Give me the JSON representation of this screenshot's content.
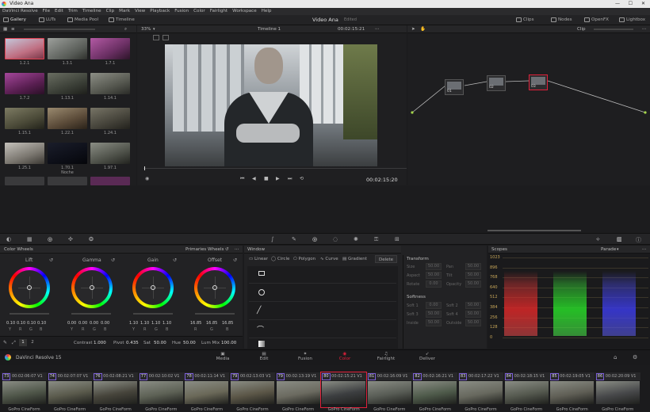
{
  "window": {
    "title": "Video Ana"
  },
  "menu": [
    "DaVinci Resolve",
    "File",
    "Edit",
    "Trim",
    "Timeline",
    "Clip",
    "Mark",
    "View",
    "Playback",
    "Fusion",
    "Color",
    "Fairlight",
    "Workspace",
    "Help"
  ],
  "toolbar": {
    "gallery": "Gallery",
    "luts": "LUTs",
    "media_pool": "Media Pool",
    "timeline": "Timeline",
    "project_name": "Video Ana",
    "edited": "Edited",
    "clips": "Clips",
    "nodes": "Nodes",
    "openfx": "OpenFX",
    "lightbox": "Lightbox"
  },
  "viewer": {
    "zoom": "33%",
    "timeline_name": "Timeline 1",
    "timecode_top": "00:02:15:21",
    "timecode": "00:02:15:20",
    "clip_mode": "Clip"
  },
  "gallery": {
    "labels": [
      "1.2.1",
      "1.3.1",
      "1.7.1",
      "1.7.2",
      "1.13.1",
      "1.14.1",
      "1.15.1",
      "1.22.1",
      "1.24.1",
      "1.25.1",
      "1.70.1",
      "1.97.1"
    ],
    "noche": "Noche"
  },
  "clips": [
    {
      "num": "73",
      "tc": "00:02:06:07",
      "track": "V1"
    },
    {
      "num": "74",
      "tc": "00:02:07:07",
      "track": "V1"
    },
    {
      "num": "76",
      "tc": "00:02:08:21",
      "track": "V1"
    },
    {
      "num": "77",
      "tc": "00:02:10:02",
      "track": "V1"
    },
    {
      "num": "78",
      "tc": "00:02:11:14",
      "track": "V1"
    },
    {
      "num": "79",
      "tc": "00:02:13:03",
      "track": "V1"
    },
    {
      "num": "79",
      "tc": "00:02:13:19",
      "track": "V1"
    },
    {
      "num": "80",
      "tc": "00:02:15:21",
      "track": "V1"
    },
    {
      "num": "81",
      "tc": "00:02:16:09",
      "track": "V1"
    },
    {
      "num": "82",
      "tc": "00:02:16:21",
      "track": "V1"
    },
    {
      "num": "83",
      "tc": "00:02:17:22",
      "track": "V1"
    },
    {
      "num": "84",
      "tc": "00:02:18:15",
      "track": "V1"
    },
    {
      "num": "85",
      "tc": "00:02:19:05",
      "track": "V1"
    },
    {
      "num": "86",
      "tc": "00:02:20:09",
      "track": "V1"
    }
  ],
  "clip_codec": "GoPro CineForm",
  "nodes": {
    "n1": "01",
    "n2": "02",
    "n3": "03"
  },
  "color_wheels": {
    "title": "Color Wheels",
    "mode": "Primaries Wheels",
    "wheels": [
      {
        "name": "Lift",
        "values": [
          "0.10",
          "0.10",
          "0.10",
          "0.10"
        ]
      },
      {
        "name": "Gamma",
        "values": [
          "0.00",
          "0.00",
          "0.00",
          "0.00"
        ]
      },
      {
        "name": "Gain",
        "values": [
          "1.10",
          "1.10",
          "1.10",
          "1.10"
        ]
      },
      {
        "name": "Offset",
        "values": [
          "16.85",
          "16.85",
          "16.85"
        ]
      }
    ],
    "chan_ybrg": [
      "Y",
      "R",
      "G",
      "B"
    ],
    "chan_rgb": [
      "R",
      "G",
      "B"
    ],
    "page1": "1",
    "page2": "2",
    "contrast_label": "Contrast",
    "contrast": "1.000",
    "pivot_label": "Pivot",
    "pivot": "0.435",
    "sat_label": "Sat",
    "sat": "50.00",
    "hue_label": "Hue",
    "hue": "50.00",
    "lummix_label": "Lum Mix",
    "lummix": "100.00"
  },
  "window_panel": {
    "title": "Window",
    "linear": "Linear",
    "circle": "Circle",
    "polygon": "Polygon",
    "curve": "Curve",
    "gradient": "Gradient",
    "delete": "Delete"
  },
  "transform": {
    "title": "Transform",
    "size_label": "Size",
    "size": "50.00",
    "pan_label": "Pan",
    "pan": "50.00",
    "aspect_label": "Aspect",
    "aspect": "50.00",
    "tilt_label": "Tilt",
    "tilt": "50.00",
    "rotate_label": "Rotate",
    "rotate": "0.00",
    "opacity_label": "Opacity",
    "opacity": "50.00",
    "softness_title": "Softness",
    "soft1_label": "Soft 1",
    "soft1": "0.00",
    "soft2_label": "Soft 2",
    "soft2": "50.00",
    "soft3_label": "Soft 3",
    "soft3": "50.00",
    "soft4_label": "Soft 4",
    "soft4": "50.00",
    "inside_label": "Inside",
    "inside": "50.00",
    "outside_label": "Outside",
    "outside": "50.00"
  },
  "scopes": {
    "title": "Scopes",
    "mode": "Parade",
    "scale": [
      "1023",
      "896",
      "768",
      "640",
      "512",
      "384",
      "256",
      "128",
      "0"
    ]
  },
  "bottom": {
    "app": "DaVinci Resolve 15",
    "pages": [
      "Media",
      "Edit",
      "Fusion",
      "Color",
      "Fairlight",
      "Deliver"
    ],
    "active": "Color"
  },
  "colors": {
    "accent": "#e0203a",
    "purple": "#7b5fd6",
    "node_green": "#a6d84a"
  }
}
